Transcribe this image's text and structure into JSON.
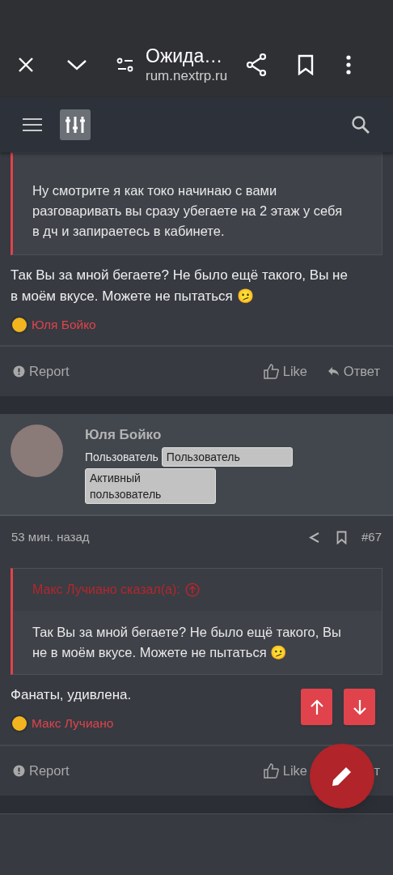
{
  "browser_bar": {
    "title": "Ожида…",
    "url": "rum.nextrp.ru"
  },
  "posts": [
    {
      "has_header": false,
      "quote": {
        "text": "Ну смотрите я как токо начинаю с вами разговаривать вы сразу убегаете на 2 этаж у себя в дч и запираетесь в кабинете."
      },
      "text": "Так Вы за мной бегаете? Не было ещё такого, Вы не в моём вкусе. Можете не пытаться 🫤",
      "reaction": {
        "name": "Юля Бойко"
      },
      "footer": {
        "report": "Report",
        "like": "Like",
        "reply": "Ответ",
        "reply_icon": true
      }
    },
    {
      "has_header": true,
      "user": {
        "name": "Юля Бойко",
        "title": "Пользователь",
        "badges": [
          "Пользователь",
          "Активный пользователь"
        ]
      },
      "time": "53 мин. назад",
      "number": "#67",
      "quote": {
        "author": "Макс Лучиано сказал(а):",
        "text": "Так Вы за мной бегаете? Не было ещё такого, Вы не в моём вкусе. Можете не пытаться 🫤"
      },
      "text": "Фанаты, удивлена.",
      "reaction": {
        "name": "Макс Лучиано"
      },
      "footer": {
        "report": "Report",
        "like": "Like",
        "reply": "т",
        "reply_icon": false
      }
    }
  ]
}
